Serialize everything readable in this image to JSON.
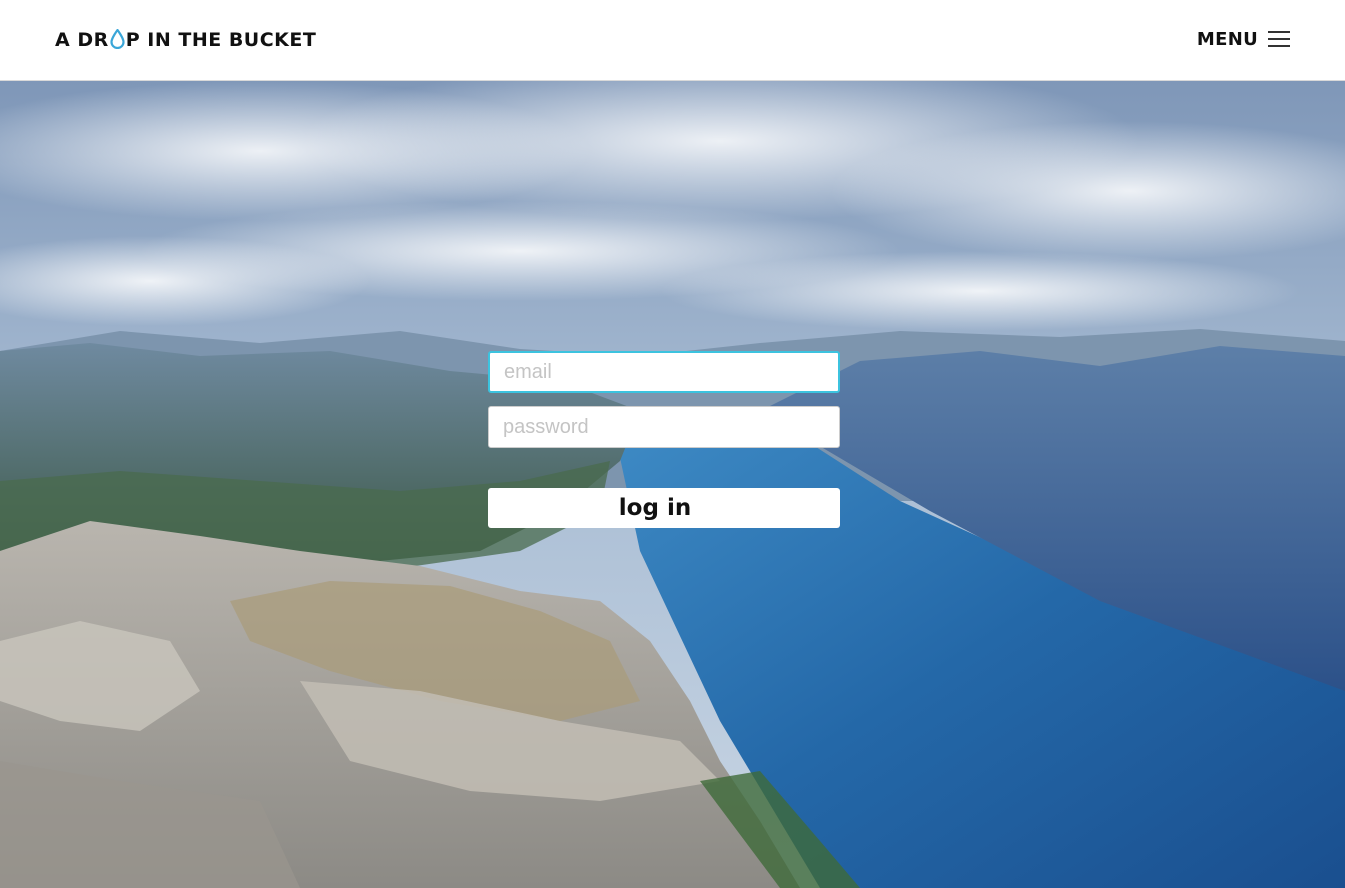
{
  "header": {
    "logo": {
      "text_before": "A DR",
      "text_after": "P IN THE BUCKET",
      "drop_icon": "water-drop-icon",
      "drop_color": "#3aa6d8"
    },
    "menu": {
      "label": "MENU",
      "icon": "hamburger-icon"
    }
  },
  "login": {
    "email": {
      "value": "",
      "placeholder": "email",
      "focus_color": "#3cc3df"
    },
    "password": {
      "value": "",
      "placeholder": "password"
    },
    "submit_label": "log in"
  },
  "background": {
    "description_icon": "fjord-landscape-photo",
    "sky_color": "#8fa7c2",
    "water_color": "#2a6ea8"
  }
}
